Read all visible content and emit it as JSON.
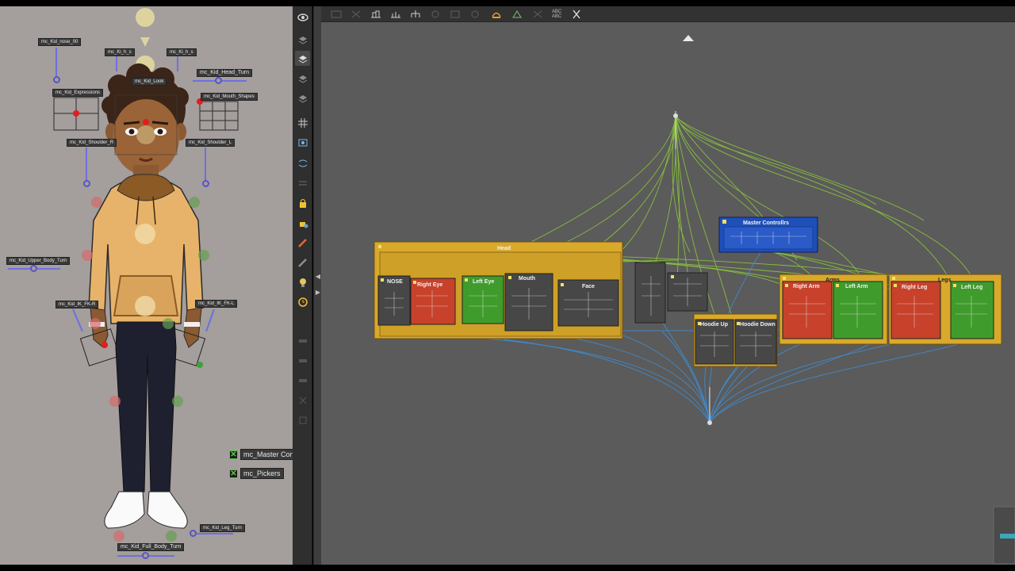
{
  "camera_view": {
    "controls": {
      "nose": "mc_Kid_nose_00",
      "small_a": "mc_Ki_h_s",
      "small_b": "mc_Ki_h_s",
      "look": "mc_Kid_Look",
      "head_turn": "mc_Kid_Head_Turn",
      "expressions": "mc_Kid_Expressions",
      "mouth_shapes": "mc_Kid_Mouth_Shapes",
      "shoulder_r": "mc_Kid_Shoulder_R",
      "shoulder_l": "mc_Kid_Shoulder_L",
      "upper_body_turn": "mc_Kid_Upper_Body_Turn",
      "ik_fk_r": "mc_Kid_IK_FK-R",
      "ik_fk_l": "mc_Kid_IK_FK-L",
      "leg_turn": "mc_Kid_Leg_Turn",
      "full_body_turn": "mc_Kid_Full_Body_Turn"
    },
    "toggles": [
      {
        "label": "mc_Master Contr",
        "checked": true
      },
      {
        "label": "mc_Pickers",
        "checked": true
      }
    ]
  },
  "left_toolbar": {
    "tools": [
      "eye-icon",
      "layers-icon",
      "layers-active-icon",
      "layers-icon",
      "layers-icon",
      "grid-icon",
      "camera-icon",
      "onion-skin-icon",
      "lock-icon",
      "lock-add-icon",
      "pencil-icon",
      "pencil-icon",
      "bulb-icon",
      "watch-icon"
    ]
  },
  "top_toolbar": {
    "tools": [
      "select-icon",
      "deselect-icon",
      "group-icon",
      "ungroup-icon",
      "tree-icon",
      "zoom-icon",
      "zoom-out-icon",
      "fit-icon",
      "backdrop-icon",
      "network-icon",
      "prefs-icon",
      "rename-icon",
      "cut-icon"
    ],
    "rename_label_top": "ABC",
    "rename_label_bottom": "ABC"
  },
  "node_view": {
    "groups": {
      "head": "Head",
      "master_controllers": "Master Controllrs",
      "arms": "Arms",
      "legs": "Legs",
      "hoodie_up": "Hoodie Up",
      "hoodie_down": "Hoodie Down"
    },
    "nodes": {
      "nose": "NOSE",
      "right_eye": "Right Eye",
      "left_eye": "Left Eye",
      "mouth": "Mouth",
      "face": "Face",
      "right_arm": "Right Arm",
      "left_arm": "Left Arm",
      "right_leg": "Right Leg",
      "left_leg": "Left Leg"
    },
    "colors": {
      "group_gold": "#d9a92c",
      "group_blue": "#1f4fb8",
      "node_red": "#c8412b",
      "node_green": "#3f9c2c",
      "wire_green": "#8cc83a",
      "wire_blue": "#3d8fd8",
      "background": "#5b5b5b"
    }
  }
}
